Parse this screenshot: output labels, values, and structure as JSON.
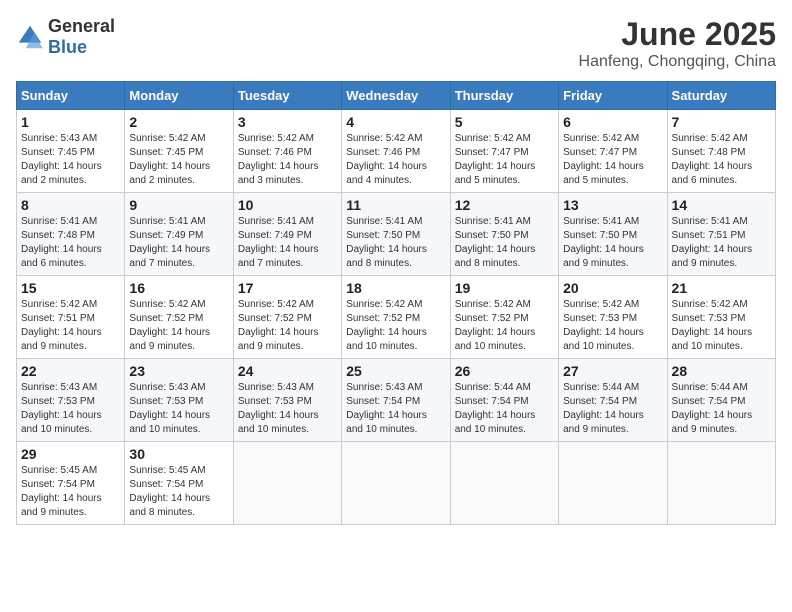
{
  "logo": {
    "general": "General",
    "blue": "Blue"
  },
  "header": {
    "month_year": "June 2025",
    "location": "Hanfeng, Chongqing, China"
  },
  "weekdays": [
    "Sunday",
    "Monday",
    "Tuesday",
    "Wednesday",
    "Thursday",
    "Friday",
    "Saturday"
  ],
  "days": [
    {
      "date": 1,
      "col": 0,
      "sunrise": "5:43 AM",
      "sunset": "7:45 PM",
      "daylight": "14 hours and 2 minutes."
    },
    {
      "date": 2,
      "col": 1,
      "sunrise": "5:42 AM",
      "sunset": "7:45 PM",
      "daylight": "14 hours and 2 minutes."
    },
    {
      "date": 3,
      "col": 2,
      "sunrise": "5:42 AM",
      "sunset": "7:46 PM",
      "daylight": "14 hours and 3 minutes."
    },
    {
      "date": 4,
      "col": 3,
      "sunrise": "5:42 AM",
      "sunset": "7:46 PM",
      "daylight": "14 hours and 4 minutes."
    },
    {
      "date": 5,
      "col": 4,
      "sunrise": "5:42 AM",
      "sunset": "7:47 PM",
      "daylight": "14 hours and 5 minutes."
    },
    {
      "date": 6,
      "col": 5,
      "sunrise": "5:42 AM",
      "sunset": "7:47 PM",
      "daylight": "14 hours and 5 minutes."
    },
    {
      "date": 7,
      "col": 6,
      "sunrise": "5:42 AM",
      "sunset": "7:48 PM",
      "daylight": "14 hours and 6 minutes."
    },
    {
      "date": 8,
      "col": 0,
      "sunrise": "5:41 AM",
      "sunset": "7:48 PM",
      "daylight": "14 hours and 6 minutes."
    },
    {
      "date": 9,
      "col": 1,
      "sunrise": "5:41 AM",
      "sunset": "7:49 PM",
      "daylight": "14 hours and 7 minutes."
    },
    {
      "date": 10,
      "col": 2,
      "sunrise": "5:41 AM",
      "sunset": "7:49 PM",
      "daylight": "14 hours and 7 minutes."
    },
    {
      "date": 11,
      "col": 3,
      "sunrise": "5:41 AM",
      "sunset": "7:50 PM",
      "daylight": "14 hours and 8 minutes."
    },
    {
      "date": 12,
      "col": 4,
      "sunrise": "5:41 AM",
      "sunset": "7:50 PM",
      "daylight": "14 hours and 8 minutes."
    },
    {
      "date": 13,
      "col": 5,
      "sunrise": "5:41 AM",
      "sunset": "7:50 PM",
      "daylight": "14 hours and 9 minutes."
    },
    {
      "date": 14,
      "col": 6,
      "sunrise": "5:41 AM",
      "sunset": "7:51 PM",
      "daylight": "14 hours and 9 minutes."
    },
    {
      "date": 15,
      "col": 0,
      "sunrise": "5:42 AM",
      "sunset": "7:51 PM",
      "daylight": "14 hours and 9 minutes."
    },
    {
      "date": 16,
      "col": 1,
      "sunrise": "5:42 AM",
      "sunset": "7:52 PM",
      "daylight": "14 hours and 9 minutes."
    },
    {
      "date": 17,
      "col": 2,
      "sunrise": "5:42 AM",
      "sunset": "7:52 PM",
      "daylight": "14 hours and 9 minutes."
    },
    {
      "date": 18,
      "col": 3,
      "sunrise": "5:42 AM",
      "sunset": "7:52 PM",
      "daylight": "14 hours and 10 minutes."
    },
    {
      "date": 19,
      "col": 4,
      "sunrise": "5:42 AM",
      "sunset": "7:52 PM",
      "daylight": "14 hours and 10 minutes."
    },
    {
      "date": 20,
      "col": 5,
      "sunrise": "5:42 AM",
      "sunset": "7:53 PM",
      "daylight": "14 hours and 10 minutes."
    },
    {
      "date": 21,
      "col": 6,
      "sunrise": "5:42 AM",
      "sunset": "7:53 PM",
      "daylight": "14 hours and 10 minutes."
    },
    {
      "date": 22,
      "col": 0,
      "sunrise": "5:43 AM",
      "sunset": "7:53 PM",
      "daylight": "14 hours and 10 minutes."
    },
    {
      "date": 23,
      "col": 1,
      "sunrise": "5:43 AM",
      "sunset": "7:53 PM",
      "daylight": "14 hours and 10 minutes."
    },
    {
      "date": 24,
      "col": 2,
      "sunrise": "5:43 AM",
      "sunset": "7:53 PM",
      "daylight": "14 hours and 10 minutes."
    },
    {
      "date": 25,
      "col": 3,
      "sunrise": "5:43 AM",
      "sunset": "7:54 PM",
      "daylight": "14 hours and 10 minutes."
    },
    {
      "date": 26,
      "col": 4,
      "sunrise": "5:44 AM",
      "sunset": "7:54 PM",
      "daylight": "14 hours and 10 minutes."
    },
    {
      "date": 27,
      "col": 5,
      "sunrise": "5:44 AM",
      "sunset": "7:54 PM",
      "daylight": "14 hours and 9 minutes."
    },
    {
      "date": 28,
      "col": 6,
      "sunrise": "5:44 AM",
      "sunset": "7:54 PM",
      "daylight": "14 hours and 9 minutes."
    },
    {
      "date": 29,
      "col": 0,
      "sunrise": "5:45 AM",
      "sunset": "7:54 PM",
      "daylight": "14 hours and 9 minutes."
    },
    {
      "date": 30,
      "col": 1,
      "sunrise": "5:45 AM",
      "sunset": "7:54 PM",
      "daylight": "14 hours and 8 minutes."
    }
  ],
  "labels": {
    "sunrise": "Sunrise:",
    "sunset": "Sunset:",
    "daylight": "Daylight:"
  }
}
